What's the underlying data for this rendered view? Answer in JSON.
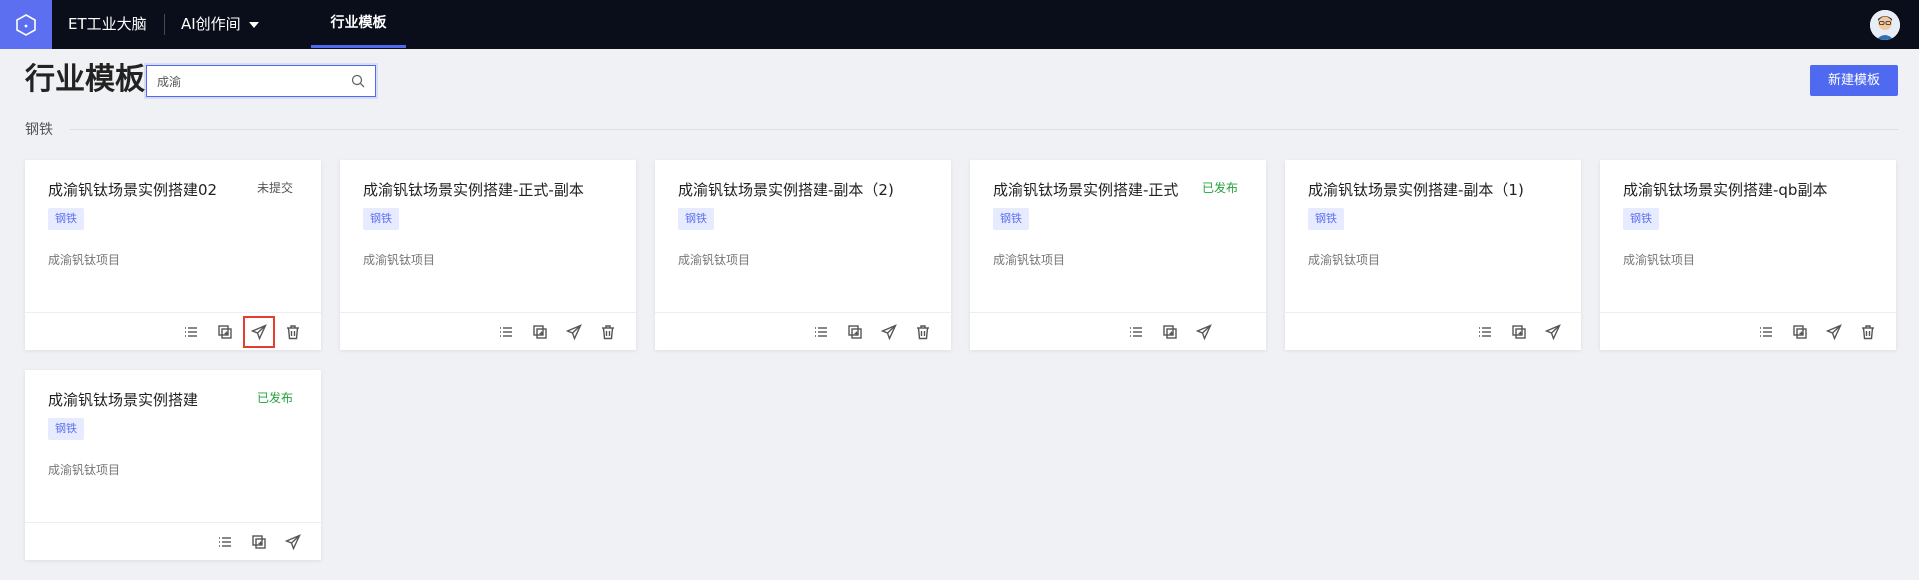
{
  "topbar": {
    "brand": "ET工业大脑",
    "ai_menu_label": "AI创作间",
    "active_tab": "行业模板"
  },
  "header": {
    "title": "行业模板",
    "search_value": "成渝",
    "new_button": "新建模板"
  },
  "section": {
    "label": "钢铁"
  },
  "cards": [
    {
      "title": "成渝钒钛场景实例搭建02",
      "status": "未提交",
      "tag": "钢铁",
      "desc": "成渝钒钛项目",
      "actions": [
        "list-icon",
        "copy-icon",
        "send-icon",
        "delete-icon"
      ]
    },
    {
      "title": "成渝钒钛场景实例搭建-正式-副本",
      "status": "",
      "tag": "钢铁",
      "desc": "成渝钒钛项目",
      "actions": [
        "list-icon",
        "copy-icon",
        "send-icon",
        "delete-icon"
      ]
    },
    {
      "title": "成渝钒钛场景实例搭建-副本（2)",
      "status": "",
      "tag": "钢铁",
      "desc": "成渝钒钛项目",
      "actions": [
        "list-icon",
        "copy-icon",
        "send-icon",
        "delete-icon"
      ]
    },
    {
      "title": "成渝钒钛场景实例搭建-正式",
      "status": "已发布",
      "tag": "钢铁",
      "desc": "成渝钒钛项目",
      "actions": [
        "list-icon",
        "copy-icon",
        "send-icon"
      ]
    },
    {
      "title": "成渝钒钛场景实例搭建-副本（1)",
      "status": "",
      "tag": "钢铁",
      "desc": "成渝钒钛项目",
      "actions": [
        "list-icon",
        "copy-icon",
        "send-icon"
      ]
    },
    {
      "title": "成渝钒钛场景实例搭建-qb副本",
      "status": "",
      "tag": "钢铁",
      "desc": "成渝钒钛项目",
      "actions": [
        "list-icon",
        "copy-icon",
        "send-icon",
        "delete-icon"
      ]
    },
    {
      "title": "成渝钒钛场景实例搭建",
      "status": "已发布",
      "tag": "钢铁",
      "desc": "成渝钒钛项目",
      "actions": [
        "list-icon",
        "copy-icon",
        "send-icon"
      ]
    }
  ],
  "colors": {
    "accent": "#4f6af0",
    "topbar": "#0a0e1a",
    "published": "#23a23b",
    "highlight": "#e53d30"
  }
}
